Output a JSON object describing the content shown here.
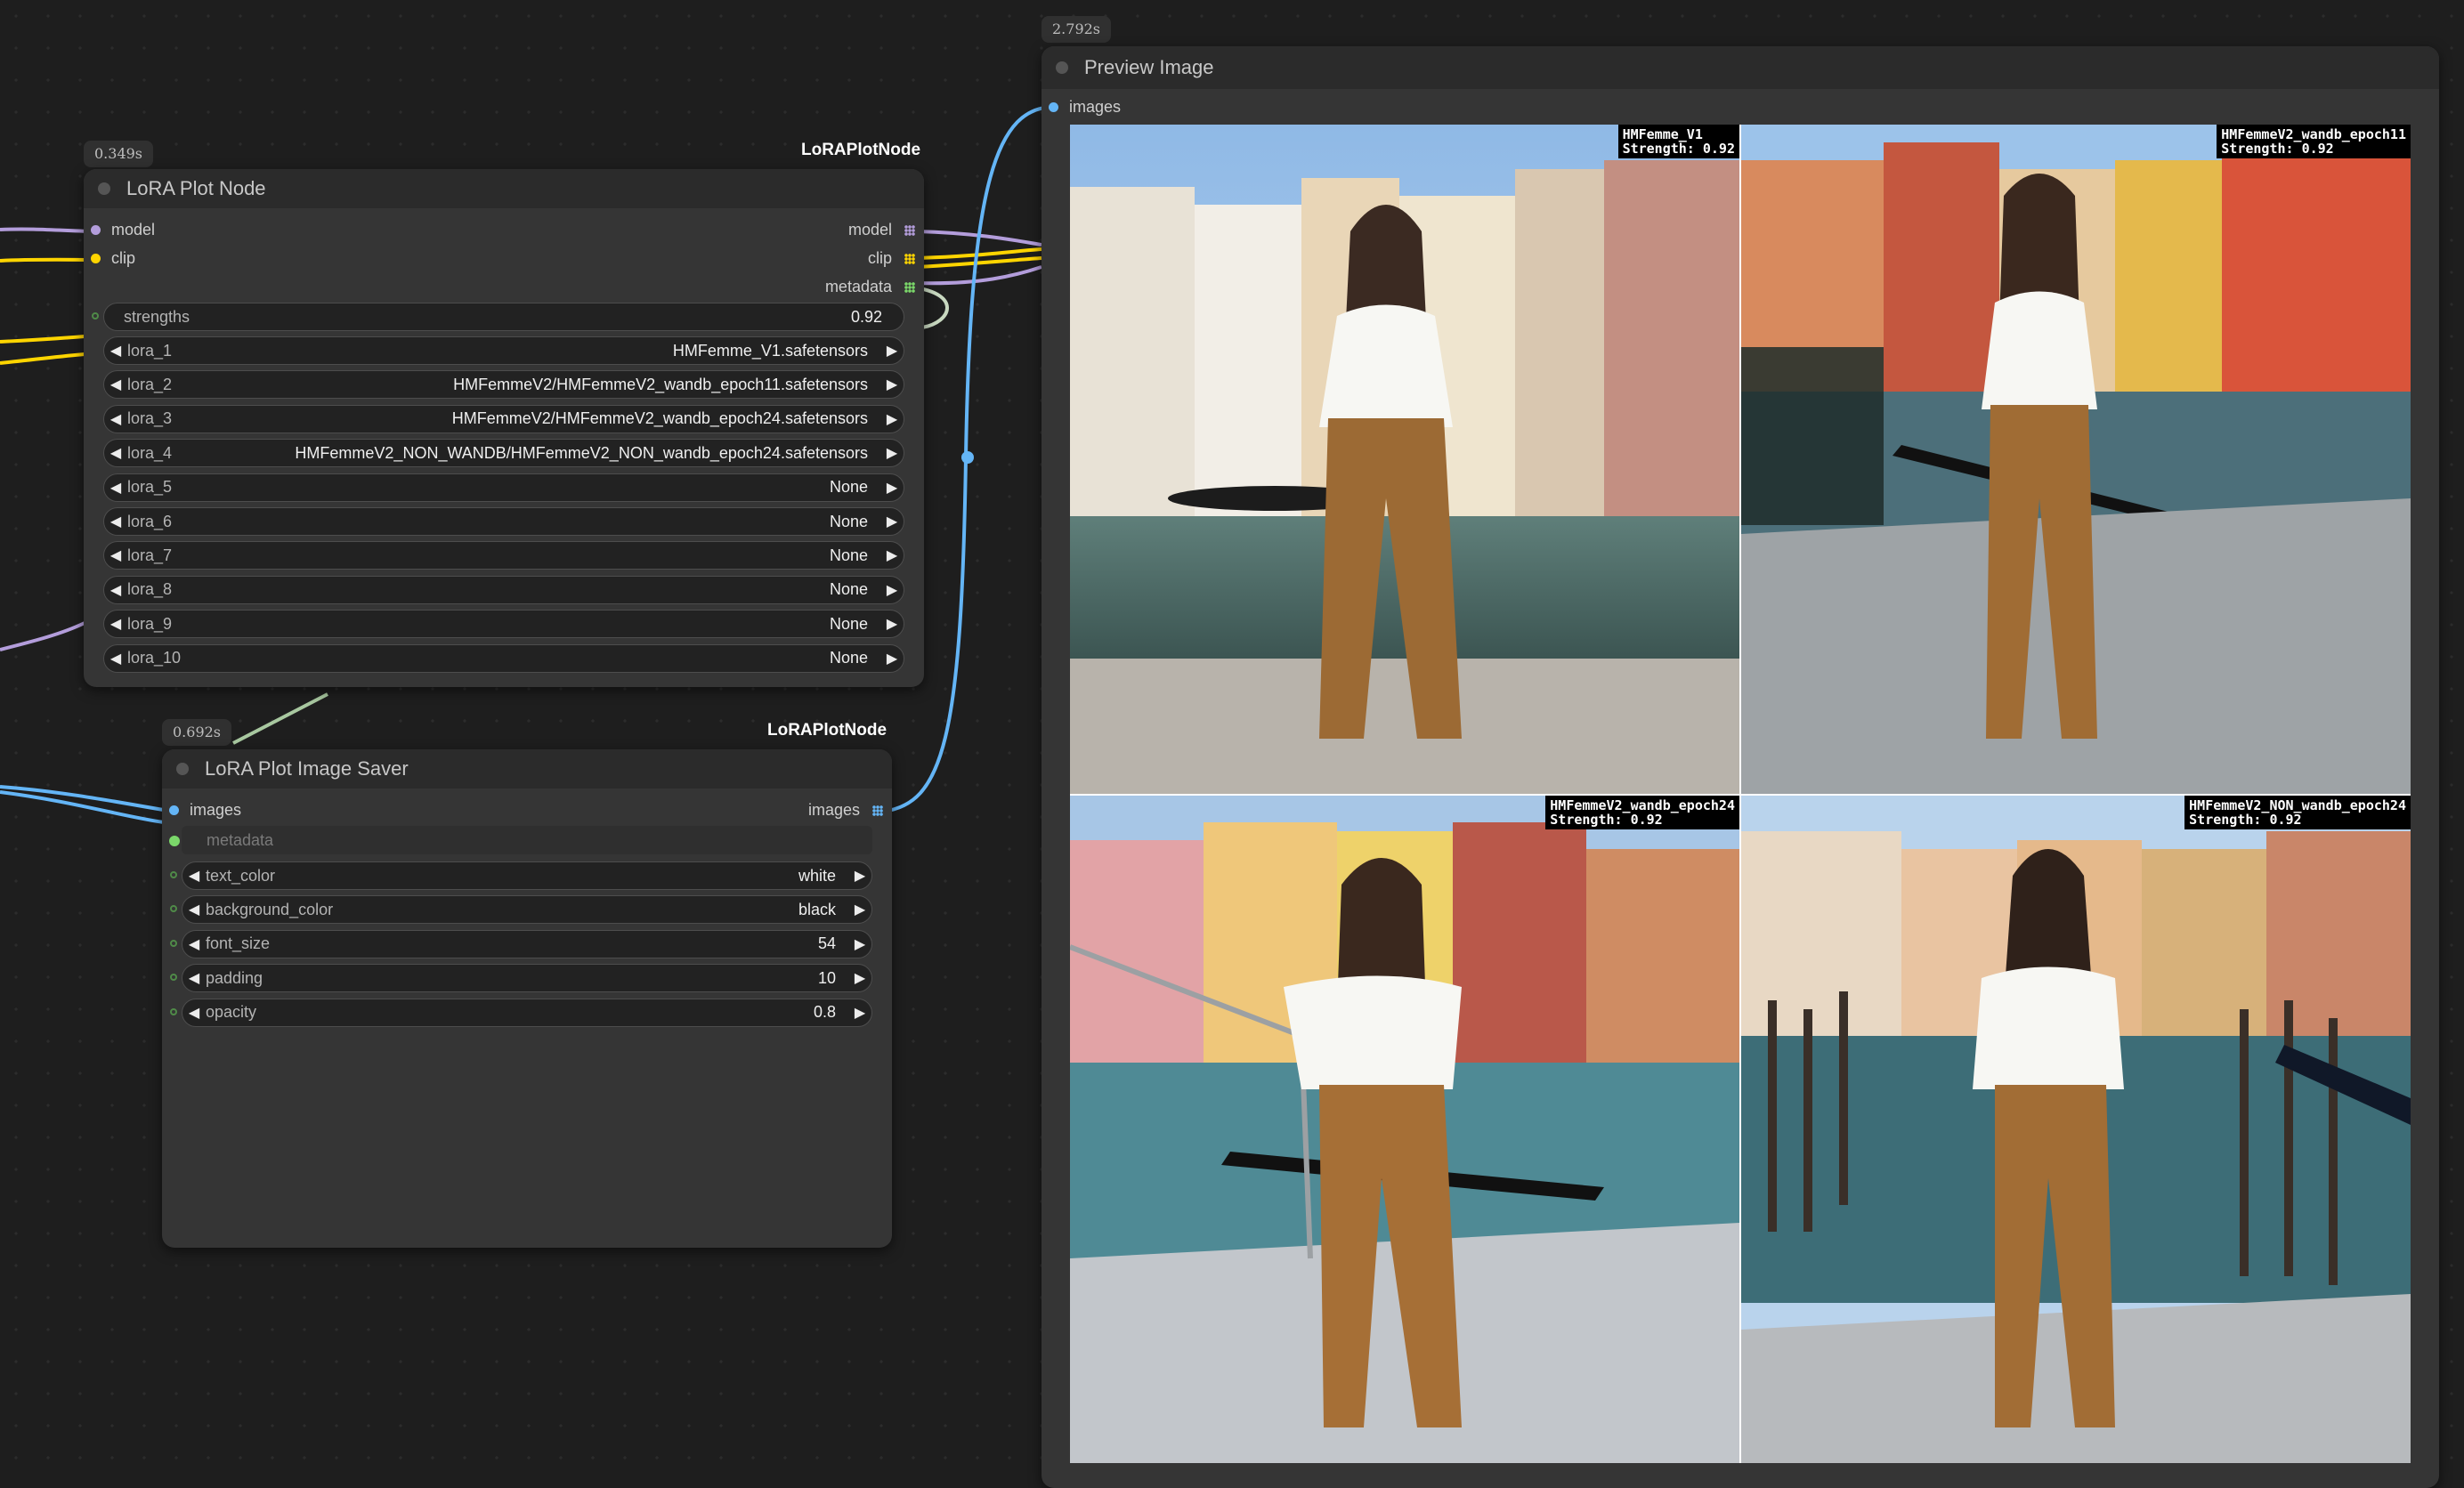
{
  "node_lora_plot": {
    "timing": "0.349s",
    "type_tag": "LoRAPlotNode",
    "title": "LoRA Plot Node",
    "inputs": [
      "model",
      "clip"
    ],
    "outputs": [
      "model",
      "clip",
      "metadata"
    ],
    "strengths": {
      "label": "strengths",
      "value": "0.92"
    },
    "loras": [
      {
        "label": "lora_1",
        "value": "HMFemme_V1.safetensors"
      },
      {
        "label": "lora_2",
        "value": "HMFemmeV2/HMFemmeV2_wandb_epoch11.safetensors"
      },
      {
        "label": "lora_3",
        "value": "HMFemmeV2/HMFemmeV2_wandb_epoch24.safetensors"
      },
      {
        "label": "lora_4",
        "value": "HMFemmeV2_NON_WANDB/HMFemmeV2_NON_wandb_epoch24.safetensors"
      },
      {
        "label": "lora_5",
        "value": "None"
      },
      {
        "label": "lora_6",
        "value": "None"
      },
      {
        "label": "lora_7",
        "value": "None"
      },
      {
        "label": "lora_8",
        "value": "None"
      },
      {
        "label": "lora_9",
        "value": "None"
      },
      {
        "label": "lora_10",
        "value": "None"
      }
    ]
  },
  "node_image_saver": {
    "timing": "0.692s",
    "type_tag": "LoRAPlotNode",
    "title": "LoRA Plot Image Saver",
    "input_images": "images",
    "input_metadata": "metadata",
    "output_images": "images",
    "widgets": [
      {
        "label": "text_color",
        "value": "white"
      },
      {
        "label": "background_color",
        "value": "black"
      },
      {
        "label": "font_size",
        "value": "54"
      },
      {
        "label": "padding",
        "value": "10"
      },
      {
        "label": "opacity",
        "value": "0.8"
      }
    ]
  },
  "node_preview": {
    "timing": "2.792s",
    "title": "Preview Image",
    "input_images": "images",
    "images": [
      {
        "name": "HMFemme_V1",
        "strength": "Strength: 0.92"
      },
      {
        "name": "HMFemmeV2_wandb_epoch11",
        "strength": "Strength: 0.92"
      },
      {
        "name": "HMFemmeV2_wandb_epoch24",
        "strength": "Strength: 0.92"
      },
      {
        "name": "HMFemmeV2_NON_wandb_epoch24",
        "strength": "Strength: 0.92"
      }
    ]
  },
  "colors": {
    "model_wire": "#b39ddb",
    "clip_wire": "#ffd500",
    "image_wire": "#64b5f6",
    "metadata_pin": "#7bd86a"
  }
}
